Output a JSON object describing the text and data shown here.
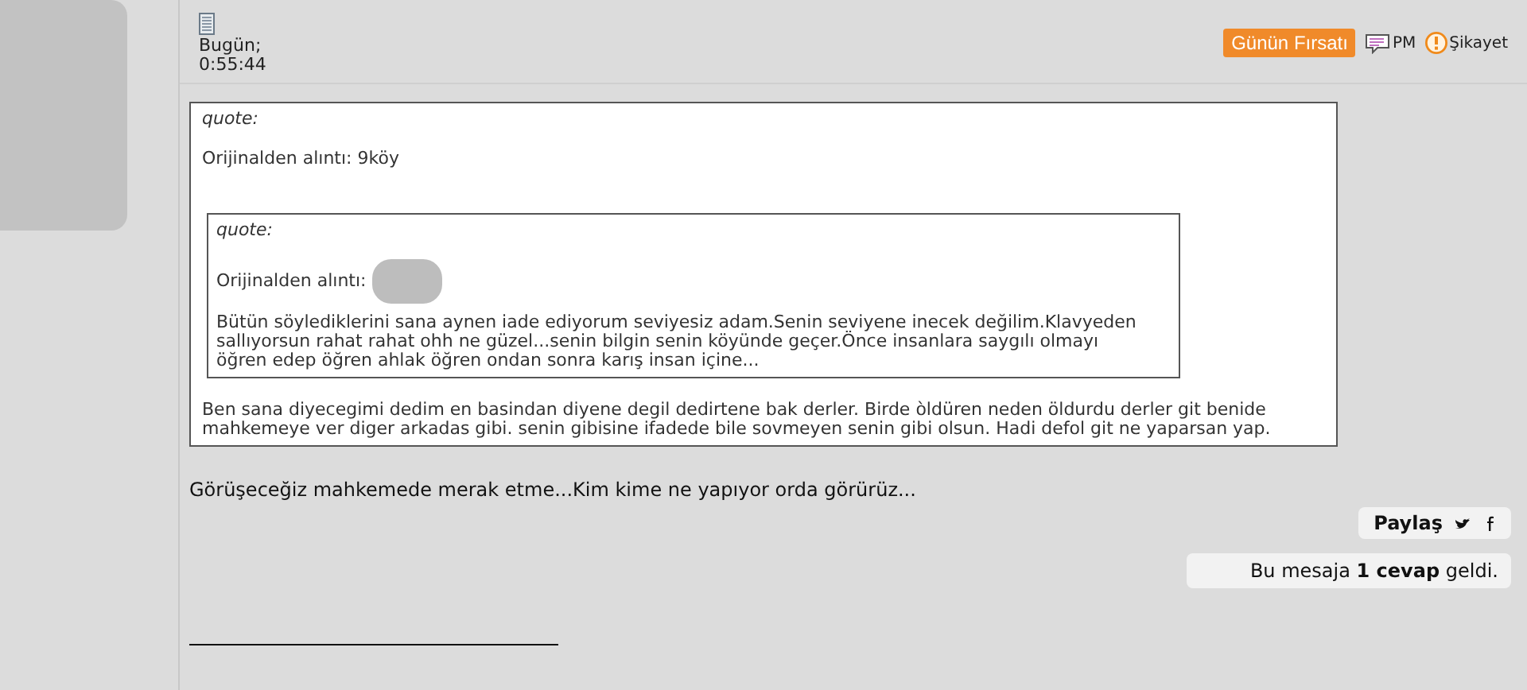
{
  "post": {
    "date": "Bugün;",
    "time": "0:55:44",
    "actions": [
      {
        "kind": "promo",
        "label": "Günün Fırsatı"
      },
      {
        "kind": "pm",
        "label": "PM"
      },
      {
        "kind": "report",
        "label": "Şikayet"
      }
    ],
    "quote": {
      "label": "quote:",
      "source": "Orijinalden alıntı: 9köy",
      "nested": {
        "label": "quote:",
        "source": "Orijinalden alıntı:",
        "lines": [
          "Bütün söylediklerini sana aynen iade ediyorum seviyesiz adam.Senin seviyene inecek değilim.Klavyeden",
          "sallıyorsun rahat rahat ohh ne güzel...senin bilgin senin köyünde geçer.Önce insanlara saygılı olmayı",
          "öğren edep öğren ahlak öğren ondan sonra karış insan içine..."
        ]
      },
      "lines": [
        "Ben sana diyecegimi dedim en basindan diyene degil dedirtene bak derler. Birde òldüren neden öldurdu derler git benide",
        "mahkemeye ver diger arkadas gibi. senin gibisine ifadede bile sovmeyen senin gibi olsun. Hadi defol git ne yaparsan yap."
      ]
    },
    "body": "Görüşeceğiz mahkemede merak etme...Kim kime ne yapıyor orda görürüz...",
    "share": {
      "label": "Paylaş"
    },
    "replies": "Bu mesaja **1 cevap** geldi."
  }
}
